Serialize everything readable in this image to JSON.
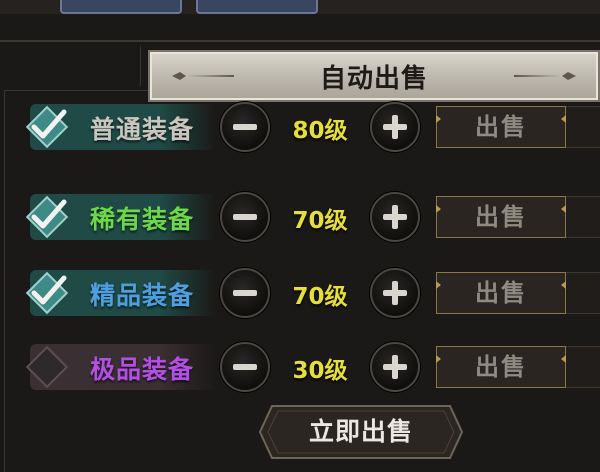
{
  "panel": {
    "title": "自动出售"
  },
  "rows": [
    {
      "label": "普通装备",
      "label_color": "#c9c6c0",
      "band_color": "#1f4a45",
      "checked": true,
      "level": "80级",
      "sell_label": "出售"
    },
    {
      "label": "稀有装备",
      "label_color": "#6ad84a",
      "band_color": "#1f4a45",
      "checked": true,
      "level": "70级",
      "sell_label": "出售"
    },
    {
      "label": "精品装备",
      "label_color": "#4f9fe0",
      "band_color": "#1f4a45",
      "checked": true,
      "level": "70级",
      "sell_label": "出售"
    },
    {
      "label": "极品装备",
      "label_color": "#b44ee6",
      "band_color": "#3a2f33",
      "checked": false,
      "level": "30级",
      "sell_label": "出售"
    }
  ],
  "icons": {
    "checkbox": "checkmark-icon",
    "decrease": "minus-icon",
    "increase": "plus-icon"
  },
  "footer": {
    "sell_now_label": "立即出售"
  }
}
